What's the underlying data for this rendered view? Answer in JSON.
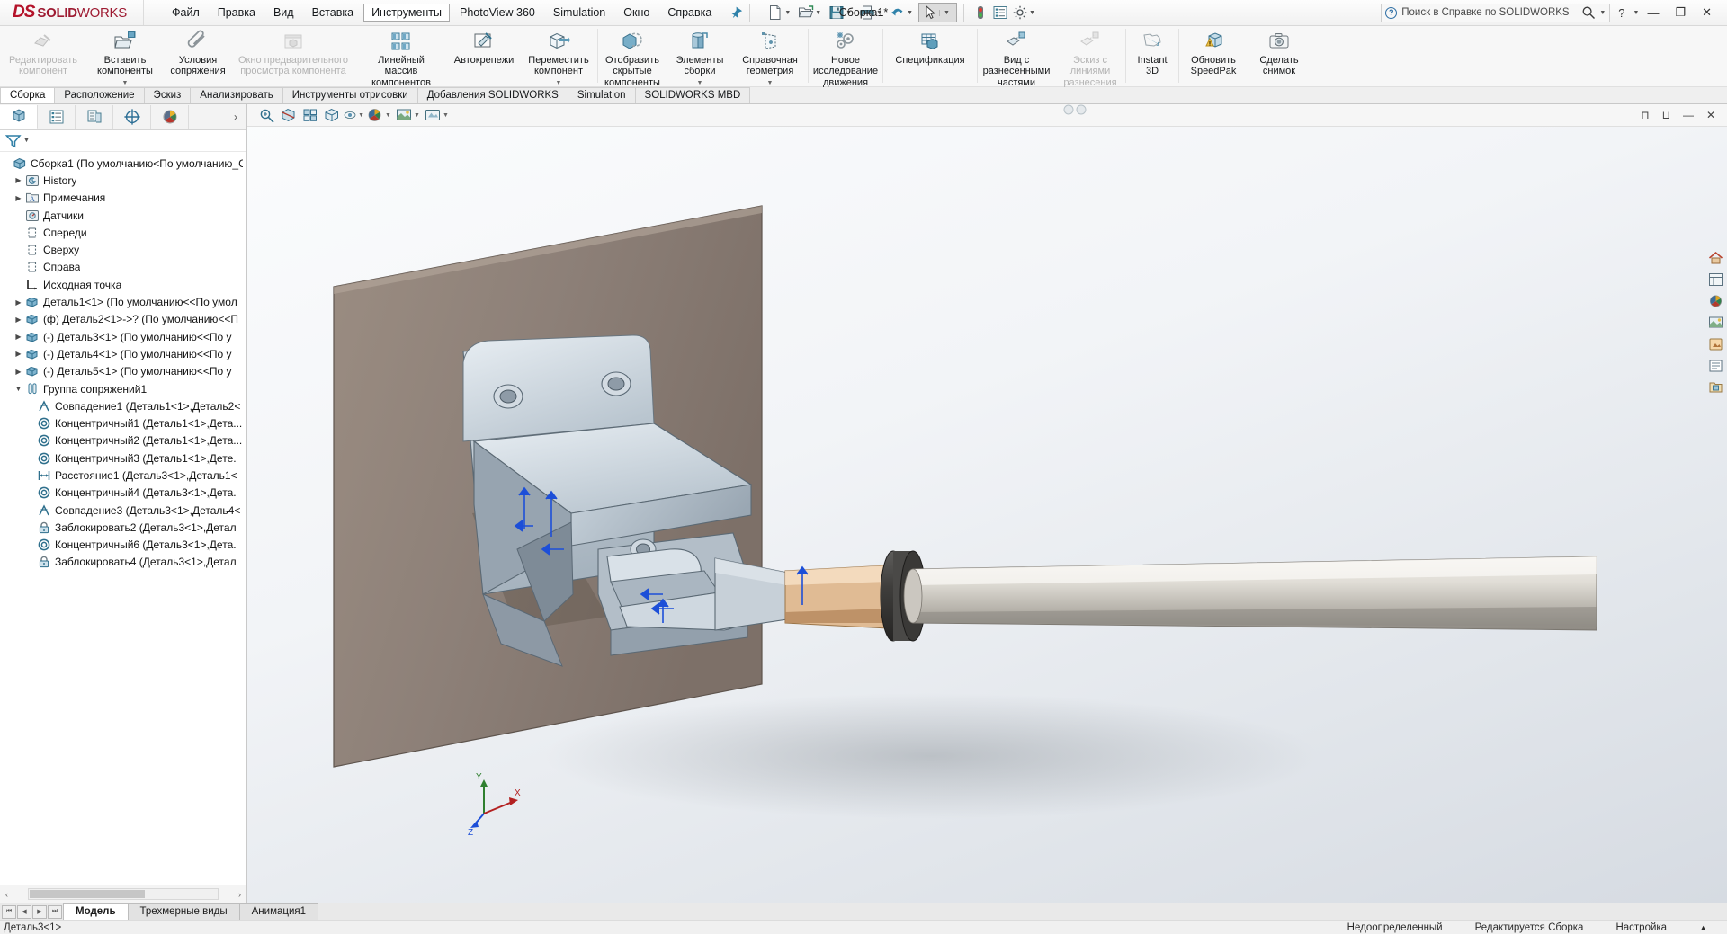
{
  "window": {
    "app_logo_ds": "DS",
    "app_logo_solid": "SOLID",
    "app_logo_works": "WORKS",
    "document_title": "Сборка1*",
    "search_placeholder": "Поиск в Справке по SOLIDWORKS",
    "help_label": "?",
    "minimize": "—",
    "maximize": "❐",
    "close": "✕"
  },
  "menu": {
    "items": [
      {
        "label": "Файл",
        "active": false
      },
      {
        "label": "Правка",
        "active": false
      },
      {
        "label": "Вид",
        "active": false
      },
      {
        "label": "Вставка",
        "active": false
      },
      {
        "label": "Инструменты",
        "active": true
      },
      {
        "label": "PhotoView 360",
        "active": false
      },
      {
        "label": "Simulation",
        "active": false
      },
      {
        "label": "Окно",
        "active": false
      },
      {
        "label": "Справка",
        "active": false
      }
    ],
    "pin_icon": "pushpin-icon"
  },
  "quick_access": {
    "buttons": [
      {
        "icon": "new-document-icon",
        "caret": true
      },
      {
        "icon": "open-folder-icon",
        "caret": true
      },
      {
        "icon": "save-icon",
        "caret": true
      },
      {
        "icon": "print-icon",
        "caret": true
      },
      {
        "icon": "undo-icon",
        "caret": true
      },
      {
        "icon": "select-arrow-icon",
        "caret": true
      },
      {
        "icon": "rebuild-traffic-light-icon",
        "caret": false
      },
      {
        "icon": "options-list-icon",
        "caret": false
      },
      {
        "icon": "gear-settings-icon",
        "caret": true
      }
    ]
  },
  "ribbon": {
    "items": [
      {
        "label": "Редактировать\nкомпонент",
        "icon": "edit-component-icon",
        "disabled": true,
        "caret": false,
        "divider_after": false
      },
      {
        "label": "Вставить\nкомпоненты",
        "icon": "insert-components-icon",
        "disabled": false,
        "caret": true,
        "divider_after": false
      },
      {
        "label": "Условия\nсопряжения",
        "icon": "mate-paperclip-icon",
        "disabled": false,
        "caret": false,
        "divider_after": false
      },
      {
        "label": "Окно предварительного\nпросмотра компонента",
        "icon": "component-preview-window-icon",
        "disabled": true,
        "caret": false,
        "divider_after": false
      },
      {
        "label": "Линейный массив\nкомпонентов",
        "icon": "linear-component-pattern-icon",
        "disabled": false,
        "caret": true,
        "divider_after": false
      },
      {
        "label": "Автокрепежи",
        "icon": "smart-fasteners-icon",
        "disabled": false,
        "caret": false,
        "divider_after": false
      },
      {
        "label": "Переместить\nкомпонент",
        "icon": "move-component-icon",
        "disabled": false,
        "caret": true,
        "divider_after": true
      },
      {
        "label": "Отобразить\nскрытые\nкомпоненты",
        "icon": "show-hidden-components-icon",
        "disabled": false,
        "caret": false,
        "divider_after": true
      },
      {
        "label": "Элементы\nсборки",
        "icon": "assembly-features-icon",
        "disabled": false,
        "caret": true,
        "divider_after": false
      },
      {
        "label": "Справочная\nгеометрия",
        "icon": "reference-geometry-icon",
        "disabled": false,
        "caret": true,
        "divider_after": true
      },
      {
        "label": "Новое\nисследование\nдвижения",
        "icon": "new-motion-study-icon",
        "disabled": false,
        "caret": false,
        "divider_after": true
      },
      {
        "label": "Спецификация",
        "icon": "bill-of-materials-icon",
        "disabled": false,
        "caret": false,
        "divider_after": true
      },
      {
        "label": "Вид с\nразнесенными\nчастями",
        "icon": "exploded-view-icon",
        "disabled": false,
        "caret": false,
        "divider_after": false
      },
      {
        "label": "Эскиз с\nлиниями\nразнесения",
        "icon": "explode-line-sketch-icon",
        "disabled": true,
        "caret": false,
        "divider_after": true
      },
      {
        "label": "Instant\n3D",
        "icon": "instant-3d-icon",
        "disabled": false,
        "caret": false,
        "divider_after": true
      },
      {
        "label": "Обновить\nSpeedPak",
        "icon": "update-speedpak-icon",
        "disabled": false,
        "caret": false,
        "divider_after": true
      },
      {
        "label": "Сделать\nснимок",
        "icon": "take-snapshot-camera-icon",
        "disabled": false,
        "caret": false,
        "divider_after": false
      }
    ]
  },
  "command_tabs": [
    {
      "label": "Сборка",
      "selected": true
    },
    {
      "label": "Расположение",
      "selected": false
    },
    {
      "label": "Эскиз",
      "selected": false
    },
    {
      "label": "Анализировать",
      "selected": false
    },
    {
      "label": "Инструменты отрисовки",
      "selected": false
    },
    {
      "label": "Добавления SOLIDWORKS",
      "selected": false
    },
    {
      "label": "Simulation",
      "selected": false
    },
    {
      "label": "SOLIDWORKS MBD",
      "selected": false
    }
  ],
  "tree_panel": {
    "tabs": [
      {
        "icon": "feature-manager-tree-icon",
        "selected": true
      },
      {
        "icon": "property-manager-icon",
        "selected": false
      },
      {
        "icon": "configuration-manager-icon",
        "selected": false
      },
      {
        "icon": "dimxpert-manager-icon",
        "selected": false
      },
      {
        "icon": "display-manager-icon",
        "selected": false
      }
    ],
    "more_icon": "chevron-right-icon",
    "filter_icon": "filter-funnel-icon",
    "items": [
      {
        "label": "Сборка1  (По умолчанию<По умолчанию_С",
        "icon": "assembly-icon",
        "indent": 0,
        "twisty": "",
        "root": true
      },
      {
        "label": "History",
        "icon": "history-icon",
        "indent": 1,
        "twisty": "▶"
      },
      {
        "label": "Примечания",
        "icon": "annotations-folder-icon",
        "indent": 1,
        "twisty": "▶"
      },
      {
        "label": "Датчики",
        "icon": "sensors-icon",
        "indent": 1,
        "twisty": ""
      },
      {
        "label": "Спереди",
        "icon": "plane-icon",
        "indent": 1,
        "twisty": ""
      },
      {
        "label": "Сверху",
        "icon": "plane-icon",
        "indent": 1,
        "twisty": ""
      },
      {
        "label": "Справа",
        "icon": "plane-icon",
        "indent": 1,
        "twisty": ""
      },
      {
        "label": "Исходная точка",
        "icon": "origin-icon",
        "indent": 1,
        "twisty": ""
      },
      {
        "label": "Деталь1<1> (По умолчанию<<По умол",
        "icon": "part-icon",
        "indent": 1,
        "twisty": "▶"
      },
      {
        "label": "(ф) Деталь2<1>->? (По умолчанию<<П",
        "icon": "part-icon",
        "indent": 1,
        "twisty": "▶"
      },
      {
        "label": "(-) Деталь3<1> (По умолчанию<<По у",
        "icon": "part-icon",
        "indent": 1,
        "twisty": "▶"
      },
      {
        "label": "(-) Деталь4<1> (По умолчанию<<По у",
        "icon": "part-icon",
        "indent": 1,
        "twisty": "▶"
      },
      {
        "label": "(-) Деталь5<1> (По умолчанию<<По у",
        "icon": "part-icon",
        "indent": 1,
        "twisty": "▶"
      },
      {
        "label": "Группа сопряжений1",
        "icon": "mate-group-icon",
        "indent": 1,
        "twisty": "▼"
      },
      {
        "label": "Совпадение1 (Деталь1<1>,Деталь2<",
        "icon": "coincident-mate-icon",
        "indent": 2,
        "twisty": ""
      },
      {
        "label": "Концентричный1 (Деталь1<1>,Дета...",
        "icon": "concentric-mate-icon",
        "indent": 2,
        "twisty": ""
      },
      {
        "label": "Концентричный2 (Деталь1<1>,Дета...",
        "icon": "concentric-mate-icon",
        "indent": 2,
        "twisty": ""
      },
      {
        "label": "Концентричный3 (Деталь1<1>,Дете.",
        "icon": "concentric-mate-icon",
        "indent": 2,
        "twisty": ""
      },
      {
        "label": "Расстояние1 (Деталь3<1>,Деталь1<",
        "icon": "distance-mate-icon",
        "indent": 2,
        "twisty": ""
      },
      {
        "label": "Концентричный4 (Деталь3<1>,Дета.",
        "icon": "concentric-mate-icon",
        "indent": 2,
        "twisty": ""
      },
      {
        "label": "Совпадение3 (Деталь3<1>,Деталь4<",
        "icon": "coincident-mate-icon",
        "indent": 2,
        "twisty": ""
      },
      {
        "label": "Заблокировать2 (Деталь3<1>,Детал",
        "icon": "lock-mate-icon",
        "indent": 2,
        "twisty": ""
      },
      {
        "label": "Концентричный6 (Деталь3<1>,Дета.",
        "icon": "concentric-mate-icon",
        "indent": 2,
        "twisty": ""
      },
      {
        "label": "Заблокировать4 (Деталь3<1>,Детал",
        "icon": "lock-mate-icon",
        "indent": 2,
        "twisty": ""
      }
    ]
  },
  "graphics_toolbar": {
    "buttons": [
      {
        "icon": "zoom-to-fit-icon",
        "caret": false
      },
      {
        "icon": "section-view-icon",
        "caret": false
      },
      {
        "icon": "view-orientation-icon",
        "caret": false
      },
      {
        "icon": "display-style-icon",
        "caret": false
      },
      {
        "icon": "hide-show-items-icon",
        "caret": true
      },
      {
        "icon": "edit-appearance-icon",
        "caret": true
      },
      {
        "icon": "apply-scene-icon",
        "caret": true
      },
      {
        "icon": "view-settings-icon",
        "caret": true
      }
    ],
    "window_buttons": [
      "restore-down-icon",
      "maximize-icon",
      "minimize-window-icon",
      "close-window-icon"
    ]
  },
  "right_toolbar": {
    "buttons": [
      "home-icon",
      "view-palette-icon",
      "appearances-icon",
      "scenes-icon",
      "decals-icon",
      "custom-properties-icon",
      "design-library-icon"
    ]
  },
  "triad": {
    "x_label": "X",
    "y_label": "Y",
    "z_label": "Z"
  },
  "bottom_tabs": {
    "nav": [
      "⏮",
      "◀",
      "▶",
      "⏭"
    ],
    "tabs": [
      {
        "label": "Модель",
        "selected": true
      },
      {
        "label": "Трехмерные виды",
        "selected": false
      },
      {
        "label": "Анимация1",
        "selected": false
      }
    ]
  },
  "status_bar": {
    "left": "Деталь3<1>",
    "underdefined": "Недоопределенный",
    "editing": "Редактируется Сборка",
    "config": "Настройка",
    "caret": "▲"
  }
}
